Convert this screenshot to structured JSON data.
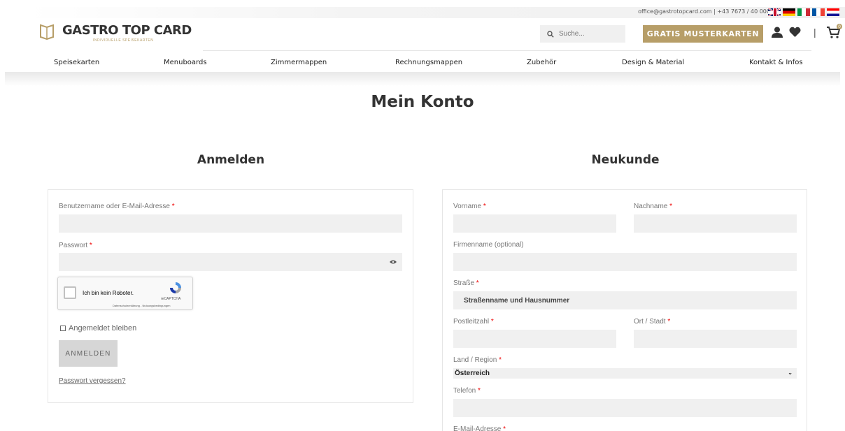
{
  "topbar": {
    "contact": "office@gastrotopcard.com | +43 7673 / 40 000",
    "flags": [
      "uk-flag",
      "de-flag",
      "it-flag",
      "fr-flag",
      "hr-flag"
    ]
  },
  "header": {
    "logo_text": "GASTRO TOP CARD",
    "logo_tagline": "INDIVIDUELLE SPEISEKARTEN",
    "search_placeholder": "Suche...",
    "cta_label": "GRATIS MUSTERKARTEN",
    "cart_count": "0",
    "separator": "|"
  },
  "nav": {
    "items": [
      "Speisekarten",
      "Menuboards",
      "Zimmermappen",
      "Rechnungsmappen",
      "Zubehör",
      "Design & Material",
      "Kontakt & Infos"
    ]
  },
  "page": {
    "title": "Mein Konto"
  },
  "login": {
    "heading": "Anmelden",
    "username_label": "Benutzername oder E-Mail-Adresse",
    "password_label": "Passwort",
    "required_marker": "*",
    "captcha_label": "Ich bin kein Roboter.",
    "captcha_brand": "reCAPTCHA",
    "captcha_links": "Datenschutzerklärung - Nutzungsbedingungen",
    "remember_label": "Angemeldet bleiben",
    "submit_label": "ANMELDEN",
    "forgot_label": "Passwort vergessen?"
  },
  "register": {
    "heading": "Neukunde",
    "firstname_label": "Vorname",
    "lastname_label": "Nachname",
    "company_label": "Firmenname (optional)",
    "street_label": "Straße",
    "street_placeholder": "Straßenname und Hausnummer",
    "zip_label": "Postleitzahl",
    "city_label": "Ort / Stadt",
    "country_label": "Land / Region",
    "country_value": "Österreich",
    "phone_label": "Telefon",
    "email_label": "E-Mail-Adresse"
  },
  "colors": {
    "accent": "#b79e68",
    "field_bg": "#f0f0f0",
    "required": "#e00000"
  }
}
